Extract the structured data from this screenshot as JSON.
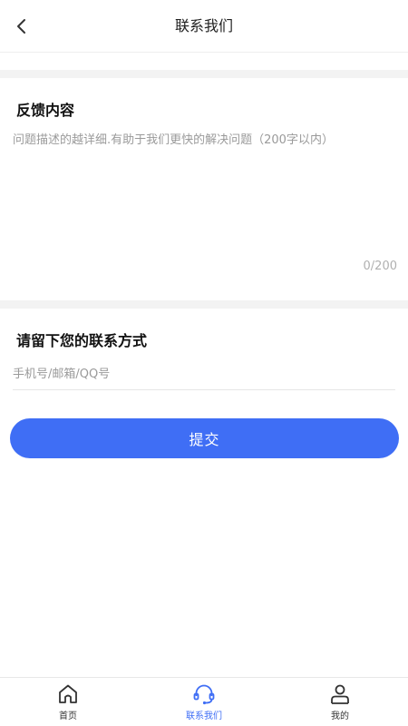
{
  "header": {
    "title": "联系我们",
    "back_icon": "chevron-left-icon"
  },
  "feedback": {
    "title": "反馈内容",
    "placeholder": "问题描述的越详细.有助于我们更快的解决问题（200字以内）",
    "value": "",
    "counter": "0/200"
  },
  "contact": {
    "title": "请留下您的联系方式",
    "placeholder": "手机号/邮箱/QQ号",
    "value": ""
  },
  "submit": {
    "label": "提交"
  },
  "tabbar": {
    "items": [
      {
        "label": "首页",
        "icon": "home-icon"
      },
      {
        "label": "联系我们",
        "icon": "headset-icon",
        "active": true
      },
      {
        "label": "我的",
        "icon": "user-icon"
      }
    ]
  },
  "colors": {
    "accent": "#3f6ef5",
    "section_gap": "#f3f3f3",
    "placeholder": "#9a9a9a"
  }
}
